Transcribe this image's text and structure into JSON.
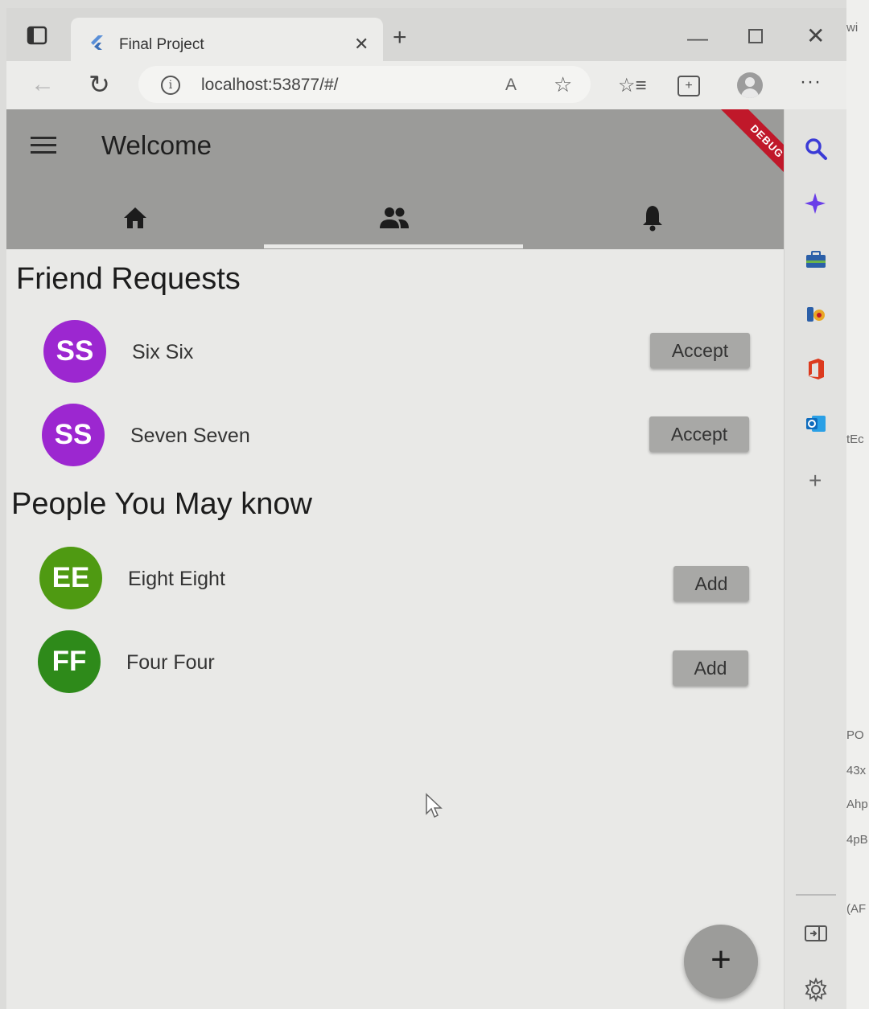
{
  "browser": {
    "tab_title": "Final Project",
    "url": "localhost:53877/#/",
    "read_aloud_label": "A"
  },
  "app": {
    "title": "Welcome",
    "debug_banner": "DEBUG",
    "tabs": [
      {
        "icon": "home-icon"
      },
      {
        "icon": "people-icon",
        "selected": true
      },
      {
        "icon": "bell-icon"
      }
    ],
    "friend_requests": {
      "title": "Friend Requests",
      "items": [
        {
          "initials": "SS",
          "name": "Six Six",
          "action": "Accept",
          "color": "#9c27d0"
        },
        {
          "initials": "SS",
          "name": "Seven Seven",
          "action": "Accept",
          "color": "#9c27d0"
        }
      ]
    },
    "people_you_may_know": {
      "title": "People You May know",
      "items": [
        {
          "initials": "EE",
          "name": "Eight Eight",
          "action": "Add",
          "color": "#4f9a12"
        },
        {
          "initials": "FF",
          "name": "Four Four",
          "action": "Add",
          "color": "#2e8a1a"
        }
      ]
    },
    "fab_label": "+"
  },
  "outer_strip_text": [
    "wi",
    "tEc",
    "PO",
    "43x",
    "Ahp",
    "4pB",
    "(AF"
  ],
  "colors": {
    "appbar": "#9b9b99",
    "button": "#a8a8a6",
    "debug": "#c0182a"
  }
}
